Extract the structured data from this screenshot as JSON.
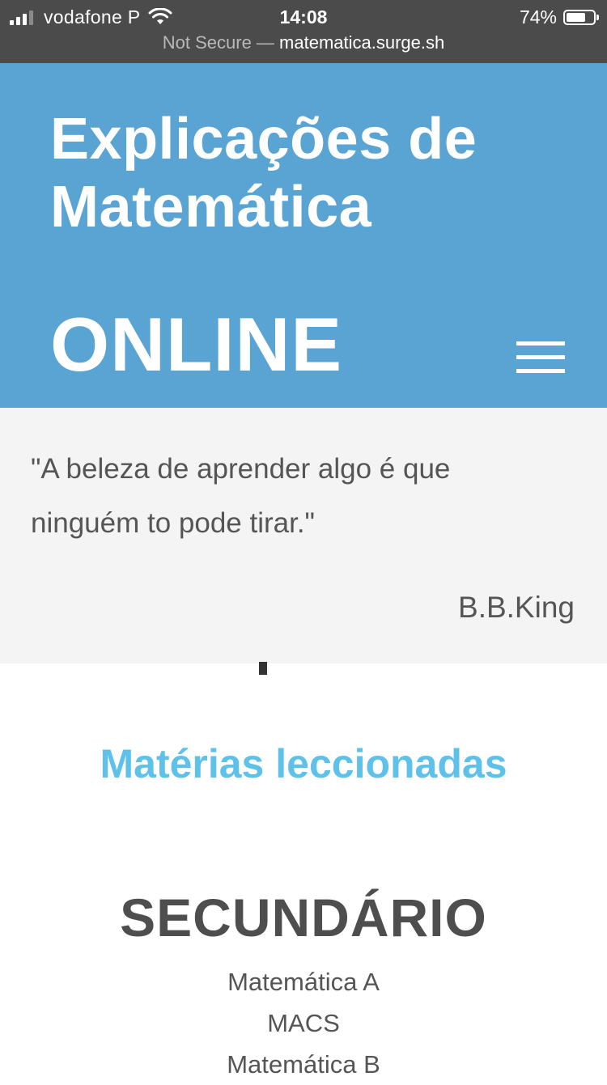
{
  "status_bar": {
    "carrier": "vodafone P",
    "time": "14:08",
    "battery": "74%",
    "battery_level": 0.74,
    "signal_icon": "signal-bars-icon",
    "wifi_icon": "wifi-icon",
    "battery_icon": "battery-icon"
  },
  "browser": {
    "security_label": "Not Secure —",
    "domain": "matematica.surge.sh"
  },
  "hero": {
    "title": "Explicações de Matemática",
    "subtitle": "ONLINE",
    "menu_icon": "hamburger-menu-icon",
    "background_color": "#5aa4d4"
  },
  "quote": {
    "text": "\"A beleza de aprender algo é que ninguém to pode tirar.\"",
    "author": "B.B.King"
  },
  "subjects": {
    "heading": "Matérias leccionadas",
    "heading_color": "#5ec1ea",
    "level": "SECUNDÁRIO",
    "items": [
      "Matemática A",
      "MACS",
      "Matemática B"
    ]
  }
}
